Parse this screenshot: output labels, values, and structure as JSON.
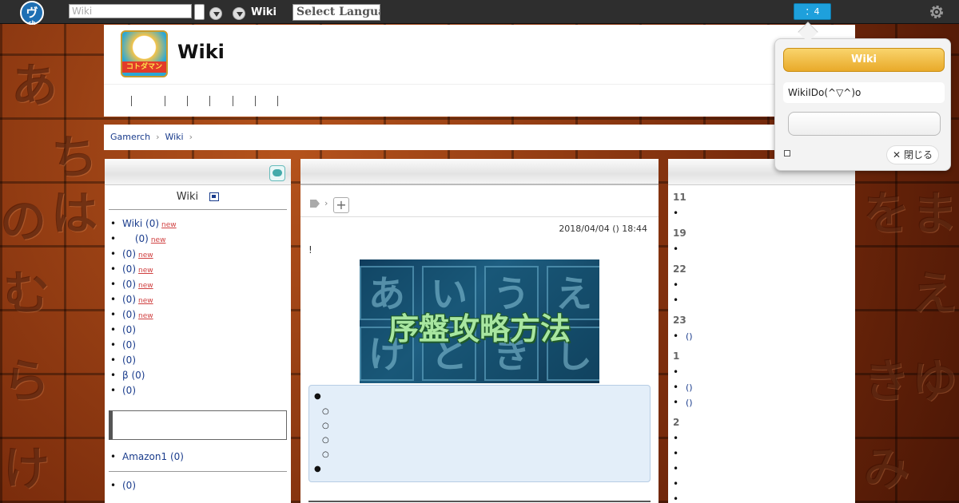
{
  "topbar": {
    "logo_text": "ヴ",
    "logo_sub": "ch",
    "search_placeholder": "Wiki",
    "site_name": "Wiki",
    "lang_select": "Select Language",
    "notify_badge": "：4"
  },
  "header": {
    "title": "Wiki",
    "logo_caption": "コトダマン"
  },
  "breadcrumb": [
    "Gamerch",
    "Wiki"
  ],
  "sidebar": {
    "title": "Wiki",
    "new_label": "new",
    "items": [
      {
        "label": "Wiki (0)",
        "new": true
      },
      {
        "label": "　 (0)",
        "new": true
      },
      {
        "label": "(0)",
        "new": true
      },
      {
        "label": "(0)",
        "new": true
      },
      {
        "label": "(0)",
        "new": true
      },
      {
        "label": "(0)",
        "new": true
      },
      {
        "label": "(0)",
        "new": true
      },
      {
        "label": "(0)",
        "new": false
      },
      {
        "label": "(0)",
        "new": false
      },
      {
        "label": "(0)",
        "new": false
      },
      {
        "label": "β (0)",
        "new": false
      },
      {
        "label": "(0)",
        "new": false
      }
    ],
    "amazon_item": "Amazon1 (0)",
    "bottom_item": "(0)"
  },
  "main": {
    "post_date": "2018/04/04 () 18:44",
    "exclaim": "!",
    "banner_text": "序盤攻略方法",
    "banner_chars": [
      "あ",
      "い",
      "う",
      "え",
      "け",
      "と",
      "き",
      "し"
    ]
  },
  "right": {
    "sections": [
      {
        "date": "11",
        "items": [
          ""
        ]
      },
      {
        "date": "19",
        "items": [
          ""
        ]
      },
      {
        "date": "22",
        "items": [
          "",
          ""
        ]
      },
      {
        "date": "23",
        "items": [
          "()"
        ]
      },
      {
        "date": "1",
        "items": [
          "",
          "()",
          "()"
        ]
      },
      {
        "date": "2",
        "items": [
          "",
          "",
          "",
          "",
          ""
        ]
      }
    ]
  },
  "popup": {
    "title": "Wiki",
    "message": "WikiIDo(^▽^)o",
    "close_label": "閉じる"
  },
  "background_chars": [
    "あ",
    "は",
    "の",
    "む",
    "ら",
    "け",
    "ち",
    "ま",
    "を",
    "え",
    "み",
    "き",
    "ゆ"
  ]
}
